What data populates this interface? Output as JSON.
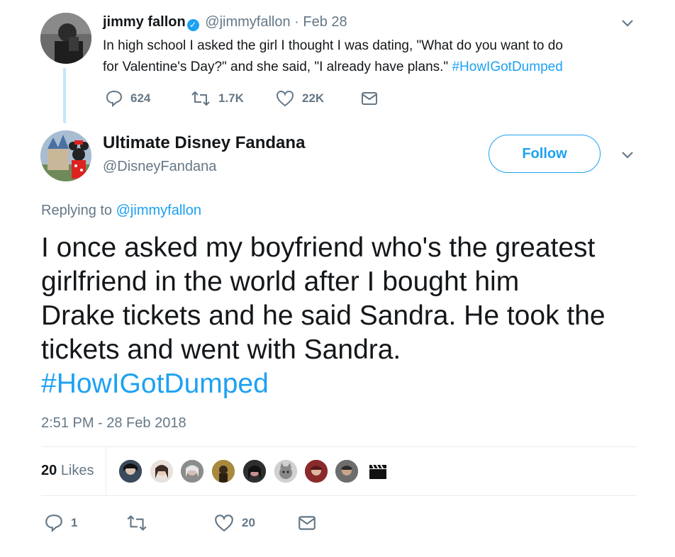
{
  "parent_tweet": {
    "display_name": "jimmy fallon",
    "handle": "@jimmyfallon",
    "date": "· Feb 28",
    "text_line1": "In high school I asked the girl I thought I was dating, \"What do you want to do",
    "text_line2": "for Valentine's Day?\" and she said, \"I already have plans.\"",
    "hashtag": "#HowIGotDumped",
    "replies": "624",
    "retweets": "1.7K",
    "likes": "22K"
  },
  "tweet": {
    "display_name": "Ultimate Disney Fandana",
    "handle": "@DisneyFandana",
    "follow_label": "Follow",
    "replying_prefix": "Replying to",
    "replying_to": "@jimmyfallon",
    "text_lines": [
      "I once asked my boyfriend who's the greatest",
      "girlfriend in the world after I bought him",
      "Drake tickets and he said Sandra. He took the",
      "tickets and went with Sandra."
    ],
    "hashtag": "#HowIGotDumped",
    "timestamp": "2:51 PM - 28 Feb 2018",
    "likes_count": "20",
    "likes_label": "Likes",
    "replies": "1",
    "retweets": "",
    "likes": "20"
  },
  "colors": {
    "accent": "#1da1f2",
    "muted": "#657786",
    "thread_line": "#c4e6f7"
  }
}
